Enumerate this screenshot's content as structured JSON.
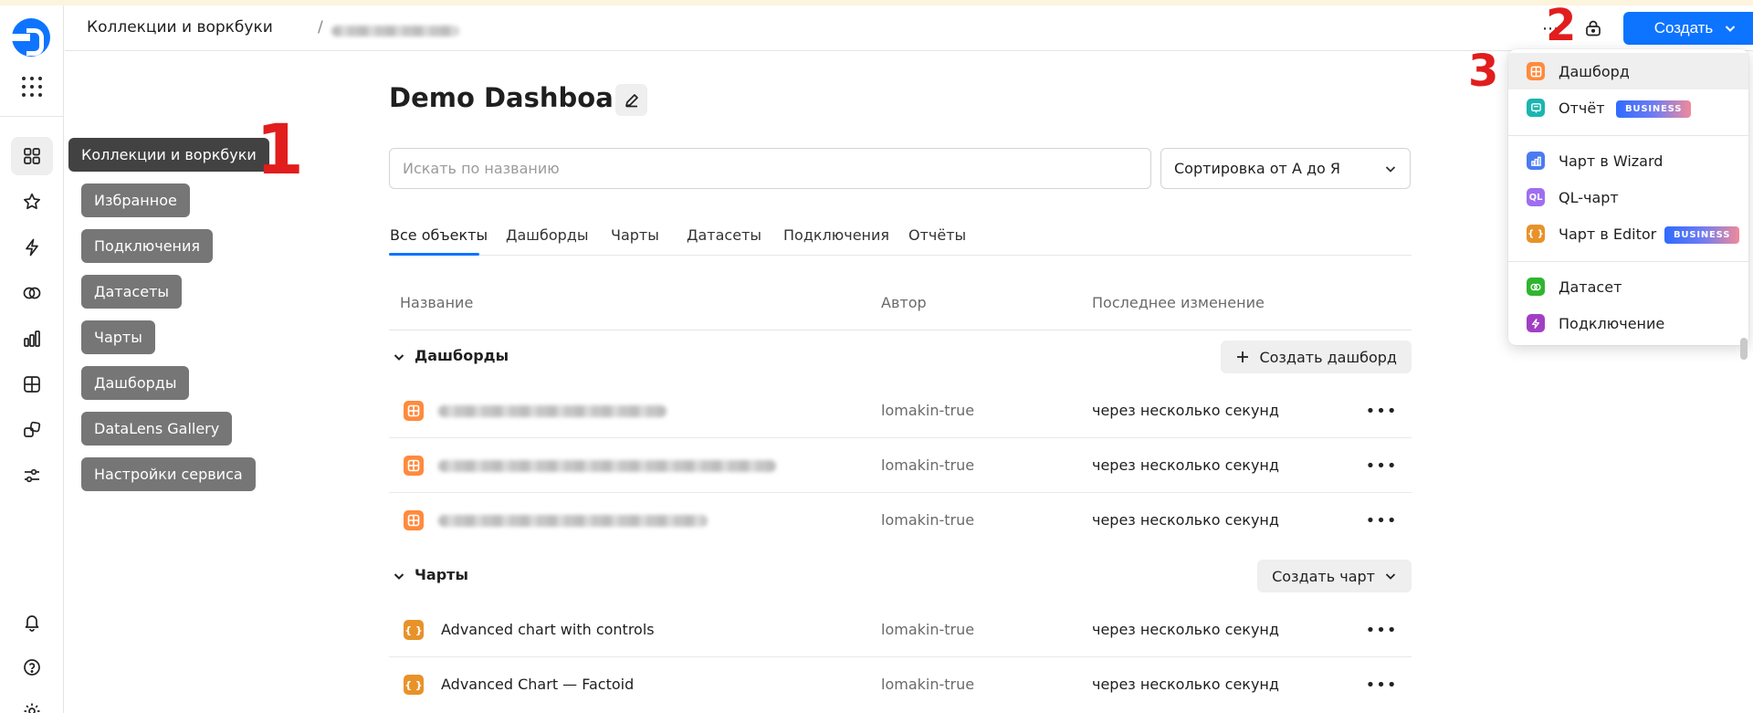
{
  "header": {
    "breadcrumb_root": "Коллекции и воркбуки",
    "breadcrumb_separator": "/",
    "create_label": "Создать"
  },
  "sidebar_tips": {
    "collections": "Коллекции и воркбуки",
    "favorites": "Избранное",
    "connections": "Подключения",
    "datasets": "Датасеты",
    "charts": "Чарты",
    "dashboards": "Дашборды",
    "gallery": "DataLens Gallery",
    "settings": "Настройки сервиса"
  },
  "callouts": [
    "1",
    "2",
    "3"
  ],
  "main": {
    "title": "Demo Dashboard",
    "search_placeholder": "Искать по названию",
    "sort_label": "Сортировка от А до Я",
    "tabs": [
      "Все объекты",
      "Дашборды",
      "Чарты",
      "Датасеты",
      "Подключения",
      "Отчёты"
    ],
    "columns": {
      "name": "Название",
      "author": "Автор",
      "changed": "Последнее изменение"
    },
    "groups": {
      "dashboards": {
        "title": "Дашборды",
        "action": "Создать дашборд",
        "rows": [
          {
            "author": "lomakin-true",
            "changed": "через несколько секунд"
          },
          {
            "author": "lomakin-true",
            "changed": "через несколько секунд"
          },
          {
            "author": "lomakin-true",
            "changed": "через несколько секунд"
          }
        ]
      },
      "charts": {
        "title": "Чарты",
        "action": "Создать чарт",
        "rows": [
          {
            "name": "Advanced chart with controls",
            "author": "lomakin-true",
            "changed": "через несколько секунд"
          },
          {
            "name": "Advanced Chart — Factoid",
            "author": "lomakin-true",
            "changed": "через несколько секунд"
          }
        ]
      }
    }
  },
  "create_menu": {
    "dashboard": "Дашборд",
    "report": "Отчёт",
    "report_badge": "BUSINESS",
    "wizard_chart": "Чарт в Wizard",
    "ql_chart": "QL-чарт",
    "ql_icon_text": "QL",
    "editor_chart": "Чарт в Editor",
    "editor_badge": "BUSINESS",
    "editor_icon_text": "{ }",
    "dataset": "Датасет",
    "connection": "Подключение"
  },
  "colors": {
    "accent": "#0d74ff",
    "callout": "#e11d1d",
    "dashboard_icon": "#ff8a3d",
    "editor_icon": "#e8922a",
    "report_icon": "#1bb5b0",
    "wizard_icon": "#4b7bf0",
    "ql_icon": "#9f6ef0",
    "dataset_icon": "#2fb52f",
    "connection_icon": "#a13fc4"
  }
}
